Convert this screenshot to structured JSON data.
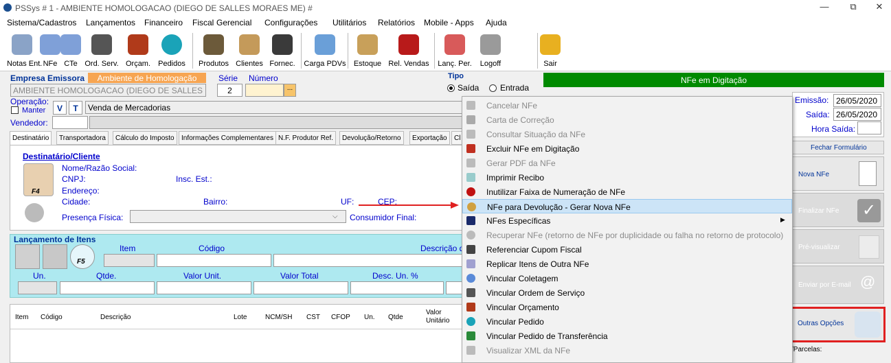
{
  "window": {
    "title": "PSSys # 1 - AMBIENTE HOMOLOGACAO (DIEGO DE SALLES MORAES ME) #",
    "minimize": "—",
    "maximize": "⧉",
    "close": "✕"
  },
  "menubar": [
    "Sistema/Cadastros",
    "Lançamentos",
    "Financeiro",
    "Fiscal",
    "Gerencial",
    "Configurações",
    "Utilitários",
    "Relatórios",
    "Mobile - Apps",
    "Ajuda"
  ],
  "toolbar": [
    "Notas Ent.",
    "NFe",
    "CTe",
    "Ord. Serv.",
    "Orçam.",
    "Pedidos",
    "Produtos",
    "Clientes",
    "Fornec.",
    "Carga PDVs",
    "Estoque",
    "Rel. Vendas",
    "Lanç. Per.",
    "Logoff",
    "Sair"
  ],
  "header": {
    "empresa_label": "Empresa Emissora",
    "ambiente_label": "Ambiente de Homologação",
    "empresa_value": "AMBIENTE HOMOLOGACAO  (DIEGO DE SALLES M",
    "serie_label": "Série",
    "serie_value": "2",
    "numero_label": "Número",
    "numero_btn": "...",
    "tipo_label": "Tipo",
    "tipo_saida": "Saída",
    "tipo_entrada": "Entrada",
    "status": "NFe em Digitação"
  },
  "operacao": {
    "label": "Operação:",
    "manter": "Manter",
    "v": "V",
    "t": "T",
    "value": "Venda de Mercadorias",
    "vendedor": "Vendedor:"
  },
  "tabs": [
    "Destinatário",
    "Transportadora",
    "Cálculo do Imposto",
    "Informações Complementares",
    "N.F. Produtor Ref.",
    "Devolução/Retorno",
    "Exportação",
    "Cl"
  ],
  "destinatario": {
    "title": "Destinatário/Cliente",
    "nome": "Nome/Razão Social:",
    "cnpj": "CNPJ:",
    "insc": "Insc. Est.:",
    "endereco": "Endereço:",
    "cidade": "Cidade:",
    "bairro": "Bairro:",
    "uf": "UF:",
    "cep": "CEP:",
    "presenca": "Presença Física:",
    "consumidor": "Consumidor Final:",
    "f4": "F4"
  },
  "itens": {
    "title": "Lançamento de Itens",
    "item": "Item",
    "codigo": "Código",
    "descricao": "Descrição d",
    "un": "Un.",
    "qtde": "Qtde.",
    "valor_unit": "Valor Unit.",
    "valor_total": "Valor Total",
    "desc_un": "Desc. Un. %",
    "f5": "F5"
  },
  "grid_headers": [
    "Item",
    "Código",
    "Descrição",
    "Lote",
    "NCM/SH",
    "CST",
    "CFOP",
    "Un.",
    "Qtde",
    "Valor Unitário"
  ],
  "right": {
    "emissao_label": "Emissão:",
    "emissao_value": "26/05/2020",
    "saida_label": "Saída:",
    "saida_value": "26/05/2020",
    "hora_label": "Hora Saída:",
    "fechar": "Fechar Formulário",
    "nova": "Nova NFe",
    "finalizar": "Finalizar NFe",
    "pre": "Pré-visualizar",
    "enviar": "Enviar por E-mail",
    "outras": "Outras Opções",
    "parcelas": "/Parcelas:"
  },
  "context_menu": [
    {
      "label": "Cancelar NFe",
      "disabled": true
    },
    {
      "label": "Carta de Correção",
      "disabled": true
    },
    {
      "label": "Consultar Situação da NFe",
      "disabled": true
    },
    {
      "label": "Excluir NFe em Digitação",
      "disabled": false
    },
    {
      "label": "Gerar PDF da NFe",
      "disabled": true
    },
    {
      "label": "Imprimir Recibo",
      "disabled": false
    },
    {
      "label": "Inutilizar Faixa de Numeração de NFe",
      "disabled": false
    },
    {
      "label": "NFe para Devolução - Gerar Nova NFe",
      "disabled": false
    },
    {
      "label": "NFes Específicas",
      "disabled": false
    },
    {
      "label": "Recuperar NFe (retorno de NFe por duplicidade ou falha no retorno de protocolo)",
      "disabled": true
    },
    {
      "label": "Referenciar Cupom Fiscal",
      "disabled": false
    },
    {
      "label": "Replicar Itens de Outra NFe",
      "disabled": false
    },
    {
      "label": "Vincular Coletagem",
      "disabled": false
    },
    {
      "label": "Vincular Ordem de Serviço",
      "disabled": false
    },
    {
      "label": "Vincular Orçamento",
      "disabled": false
    },
    {
      "label": "Vincular Pedido",
      "disabled": false
    },
    {
      "label": "Vincular Pedido de Transferência",
      "disabled": false
    },
    {
      "label": "Visualizar XML da NFe",
      "disabled": true
    }
  ],
  "colors": {
    "status_green": "#008a00",
    "highlight": "#cce4f7",
    "cyan_panel": "#aee9f0",
    "orange_tab": "#f7a552",
    "red_arrow": "#e02020"
  }
}
